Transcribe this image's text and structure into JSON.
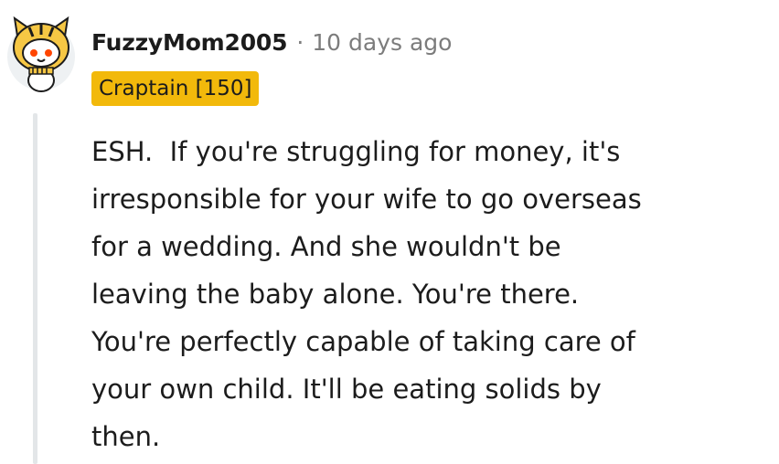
{
  "comment": {
    "author": "FuzzyMom2005",
    "separator": "·",
    "timestamp": "10 days ago",
    "flair": "Craptain [150]",
    "body": "ESH.  If you're struggling for money, it's\nirresponsible for your wife to go overseas\nfor a wedding. And she wouldn't be\nleaving the baby alone. You're there.\nYou're perfectly capable of taking care of\nyour own child. It'll be eating solids by\nthen.",
    "avatar_icon": "snoo-tiger-avatar-icon"
  },
  "colors": {
    "flair_background": "#f2b90b",
    "text": "#1c1c1c",
    "meta": "#7c7c7c",
    "thread_line": "#e3e6e8"
  }
}
